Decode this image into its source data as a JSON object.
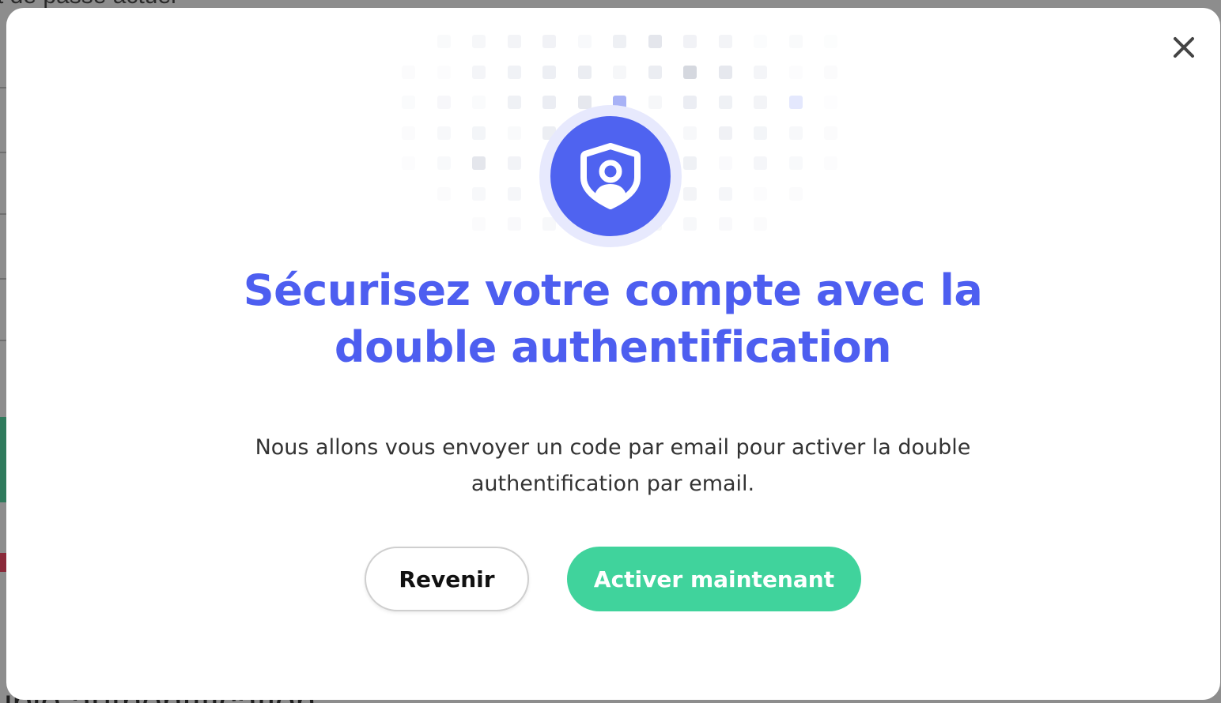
{
  "background": {
    "top_text": "t de passe actuel",
    "bottom_text": "uble authentification"
  },
  "modal": {
    "close_icon": "close-icon",
    "hero_icon": "shield-user-icon",
    "title": "Sécurisez votre compte avec la double authentification",
    "description": "Nous allons vous envoyer un code par email pour activer la double authentification par email.",
    "buttons": {
      "back_label": "Revenir",
      "activate_label": "Activer maintenant"
    }
  },
  "colors": {
    "accent": "#4d5ef0",
    "primary_button": "#40d39c",
    "shield": "#4f63f0",
    "shield_halo": "#e7e9fd"
  }
}
